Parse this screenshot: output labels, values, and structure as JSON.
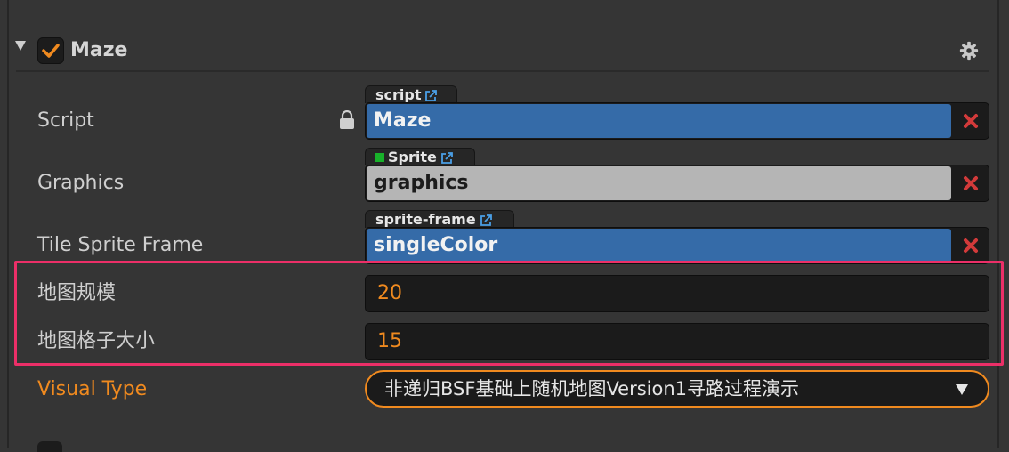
{
  "component": {
    "title": "Maze",
    "enabled": true,
    "settings_icon": "gear-icon",
    "fold_icon": "triangle-down-icon"
  },
  "properties": {
    "script": {
      "label": "Script",
      "tag": "script",
      "value": "Maze",
      "lock_icon": "lock-icon"
    },
    "graphics": {
      "label": "Graphics",
      "tag": "Sprite",
      "value": "graphics"
    },
    "tile_sprite_frame": {
      "label": "Tile Sprite Frame",
      "tag": "sprite-frame",
      "value": "singleColor"
    },
    "map_size": {
      "label": "地图规模",
      "value": "20"
    },
    "tile_size": {
      "label": "地图格子大小",
      "value": "15"
    },
    "visual_type": {
      "label": "Visual Type",
      "selected": "非递归BSF基础上随机地图Version1寻路过程演示"
    }
  },
  "colors": {
    "accent": "#f08a1f",
    "highlight": "#ec2f68",
    "asset_blue": "#356ba8",
    "clear_red": "#d23a3a",
    "link_blue": "#4a9fe6"
  }
}
